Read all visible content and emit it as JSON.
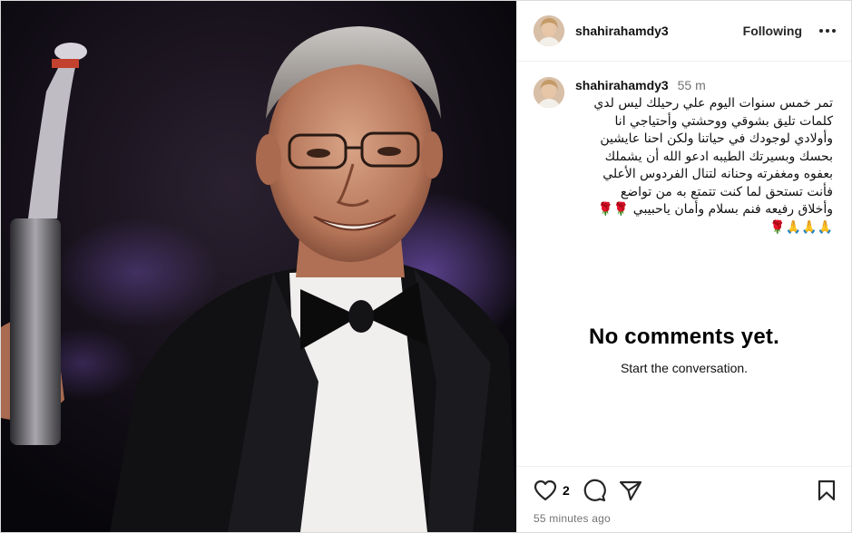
{
  "post": {
    "username": "shahirahamdy3",
    "follow_label": "Following",
    "more_icon": "more-options-icon",
    "caption_time": "55 m",
    "caption_lines": [
      "تمر خمس سنوات اليوم علي رحيلك ليس لدي",
      "كلمات تليق بشوقي ووحشتي وأحتياجي انا",
      "وأولادي لوجودك في حياتنا ولكن احنا عايشين",
      "بحسك وبسيرتك الطيبه  ادعو الله أن يشملك",
      "بعفوه ومغفرته وحنانه لتنال الفردوس الأعلي",
      "فأنت تستحق لما كنت تتمتع به من تواضع",
      "وأخلاق رفيعه  فنم بسلام وأمان  ياحبيبي 🌹🌹",
      "🙏🙏🙏🌹"
    ],
    "likes": "2",
    "posted_ago": "55 minutes ago"
  },
  "comments": {
    "empty_title": "No comments yet.",
    "empty_subtitle": "Start the conversation."
  },
  "icons": {
    "like": "heart-icon",
    "comment": "comment-bubble-icon",
    "share": "share-paper-plane-icon",
    "save": "bookmark-icon"
  }
}
